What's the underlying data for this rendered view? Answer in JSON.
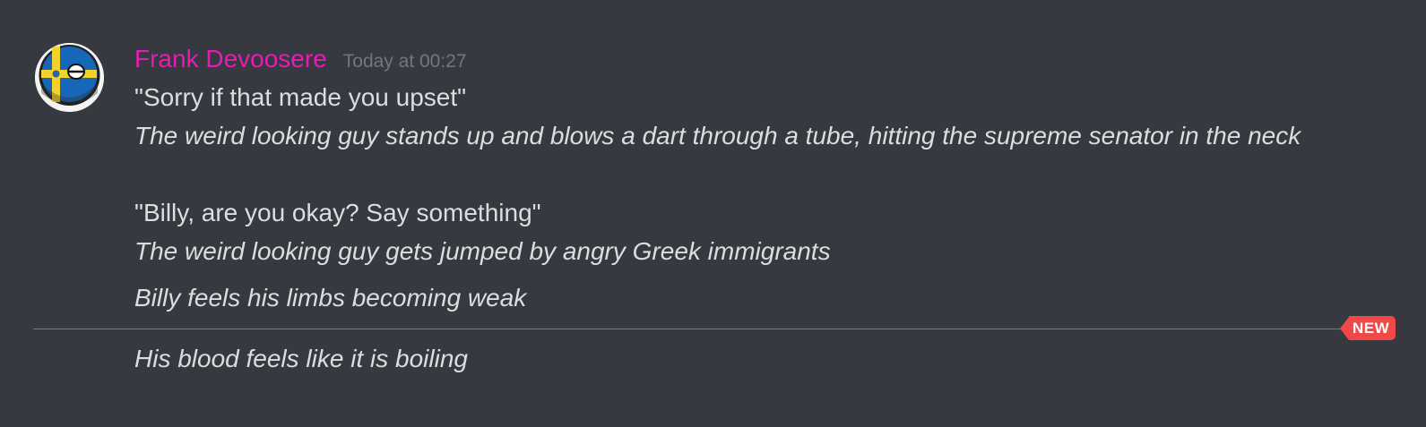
{
  "message": {
    "author": "Frank Devoosere",
    "author_color": "#e91bb6",
    "timestamp": "Today at 00:27",
    "avatar_icon": "sweden-countryball-avatar",
    "lines": [
      {
        "text": "\"Sorry if that made you upset\"",
        "style": "normal"
      },
      {
        "text": "The weird looking guy stands up and blows a dart through a tube, hitting the supreme senator in the neck",
        "style": "italic"
      },
      {
        "text": "\"Billy, are you okay? Say something\"",
        "style": "normal"
      },
      {
        "text": "The weird looking guy gets jumped by angry Greek immigrants",
        "style": "italic"
      },
      {
        "text": "Billy feels his limbs becoming weak",
        "style": "italic"
      }
    ]
  },
  "new_divider": {
    "label": "NEW",
    "color": "#f04747"
  },
  "next_message": {
    "lines": [
      {
        "text": "His blood feels like it is boiling",
        "style": "italic"
      }
    ]
  }
}
